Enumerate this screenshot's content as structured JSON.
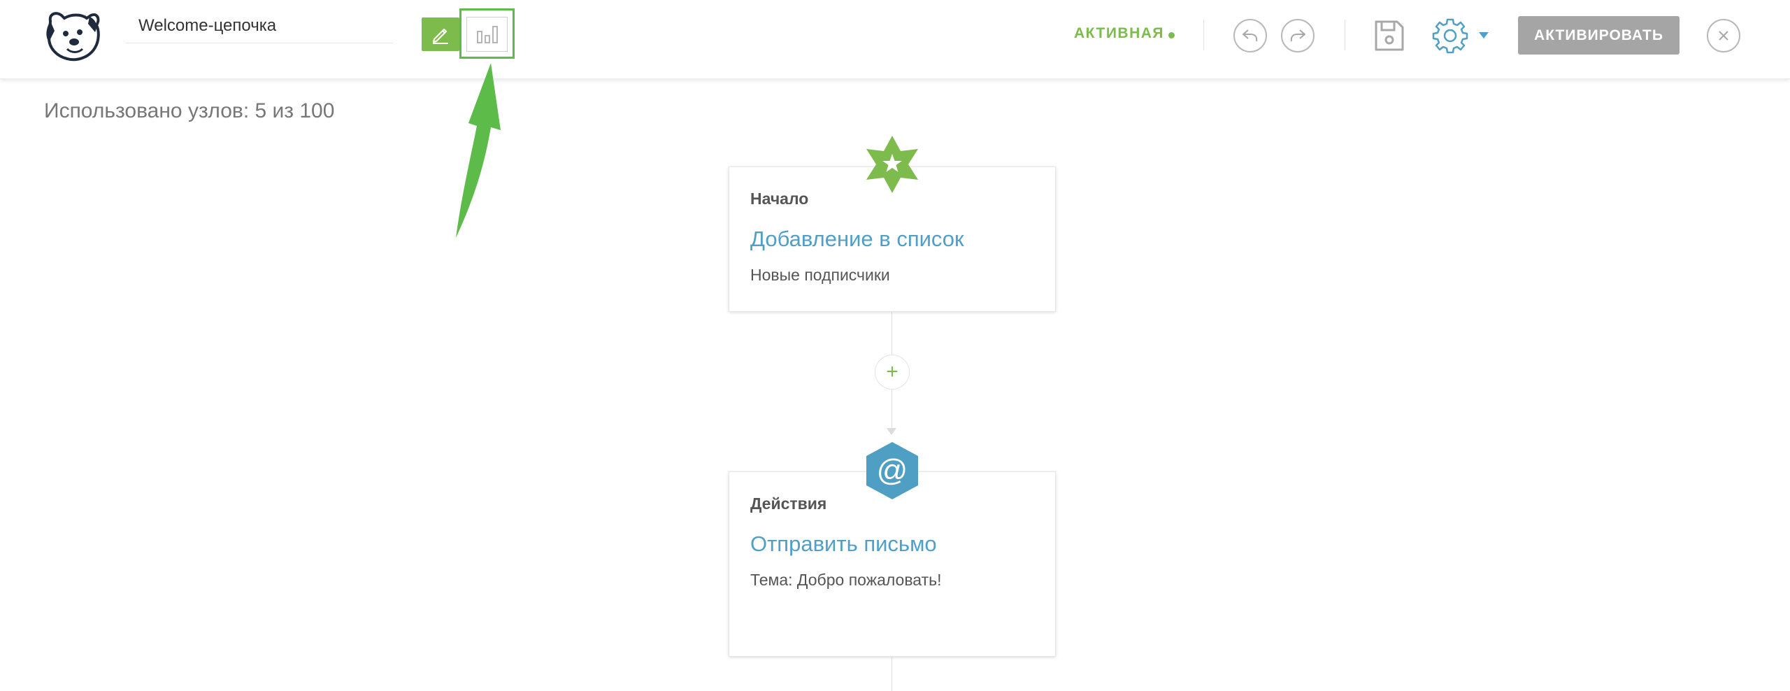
{
  "header": {
    "chain_name": "Welcome-цепочка",
    "status_label": "АКТИВНАЯ",
    "activate_label": "АКТИВИРОВАТЬ"
  },
  "nodes_used": "Использовано узлов: 5 из 100",
  "nodes": [
    {
      "type": "Начало",
      "title": "Добавление в список",
      "subtitle": "Новые подписчики",
      "badge_icon": "star-icon"
    },
    {
      "type": "Действия",
      "title": "Отправить письмо",
      "subtitle": "Тема: Добро пожаловать!",
      "badge_icon": "email-at-icon",
      "badge_glyph": "@"
    }
  ],
  "add_node_glyph": "+",
  "colors": {
    "accent_green": "#7cbb4c",
    "highlight_green": "#5dbb4a",
    "accent_blue": "#4fa0c8",
    "activate_gray": "#a5a5a5"
  }
}
